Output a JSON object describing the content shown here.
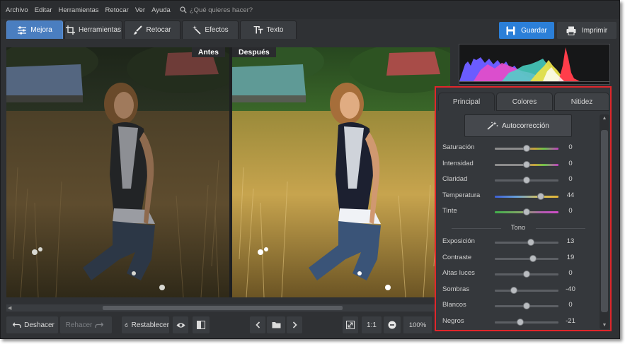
{
  "menu": {
    "items": [
      "Archivo",
      "Editar",
      "Herramientas",
      "Retocar",
      "Ver",
      "Ayuda"
    ],
    "search_placeholder": "¿Qué quieres hacer?"
  },
  "tabs": [
    {
      "label": "Mejora",
      "icon": "sliders-icon",
      "active": true
    },
    {
      "label": "Herramientas",
      "icon": "crop-icon",
      "active": false
    },
    {
      "label": "Retocar",
      "icon": "brush-icon",
      "active": false
    },
    {
      "label": "Efectos",
      "icon": "magic-wand-icon",
      "active": false
    },
    {
      "label": "Texto",
      "icon": "text-icon",
      "active": false
    }
  ],
  "actions": {
    "save_label": "Guardar",
    "print_label": "Imprimir"
  },
  "photo": {
    "before_label": "Antes",
    "after_label": "Después"
  },
  "bottom": {
    "undo_label": "Deshacer",
    "redo_label": "Rehacer",
    "reset_label": "Restablecer",
    "actual_size_label": "1:1",
    "zoom": "100%"
  },
  "panel": {
    "tabs": [
      {
        "label": "Principal",
        "active": true
      },
      {
        "label": "Colores",
        "active": false
      },
      {
        "label": "Nitidez",
        "active": false
      }
    ],
    "autocorrect_label": "Autocorrección",
    "section_tono": "Tono",
    "sliders": [
      {
        "label": "Saturación",
        "value": "0",
        "pos": 0.5,
        "track": "saturation"
      },
      {
        "label": "Intensidad",
        "value": "0",
        "pos": 0.5,
        "track": "saturation"
      },
      {
        "label": "Claridad",
        "value": "0",
        "pos": 0.5,
        "track": "gray"
      },
      {
        "label": "Temperatura",
        "value": "44",
        "pos": 0.72,
        "track": "temperature"
      },
      {
        "label": "Tinte",
        "value": "0",
        "pos": 0.5,
        "track": "tint"
      }
    ],
    "tone_sliders": [
      {
        "label": "Exposición",
        "value": "13",
        "pos": 0.565,
        "track": "gray"
      },
      {
        "label": "Contraste",
        "value": "19",
        "pos": 0.595,
        "track": "gray"
      },
      {
        "label": "Altas luces",
        "value": "0",
        "pos": 0.5,
        "track": "gray"
      },
      {
        "label": "Sombras",
        "value": "-40",
        "pos": 0.3,
        "track": "gray"
      },
      {
        "label": "Blancos",
        "value": "0",
        "pos": 0.5,
        "track": "gray"
      },
      {
        "label": "Negros",
        "value": "-21",
        "pos": 0.395,
        "track": "gray"
      }
    ]
  },
  "colors": {
    "accent": "#2b7fd8",
    "active_tab": "#4a7ec0",
    "highlight_border": "#e0262b"
  }
}
